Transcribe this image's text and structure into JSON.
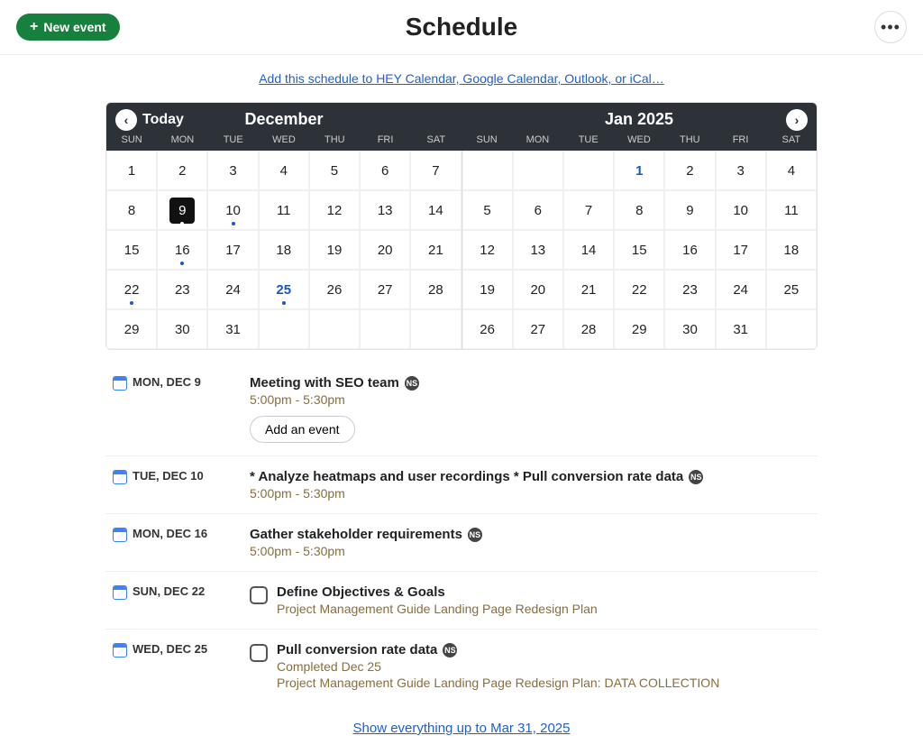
{
  "header": {
    "new_event_label": "New event",
    "title": "Schedule",
    "more_label": "•••"
  },
  "add_schedule_link": "Add this schedule to HEY Calendar, Google Calendar, Outlook, or iCal…",
  "calendar": {
    "today_label": "Today",
    "dow": [
      "SUN",
      "MON",
      "TUE",
      "WED",
      "THU",
      "FRI",
      "SAT"
    ],
    "months": [
      {
        "title": "December",
        "days": [
          {
            "n": 1
          },
          {
            "n": 2
          },
          {
            "n": 3
          },
          {
            "n": 4
          },
          {
            "n": 5
          },
          {
            "n": 6
          },
          {
            "n": 7
          },
          {
            "n": 8
          },
          {
            "n": 9,
            "selected": true,
            "dot": true
          },
          {
            "n": 10,
            "dot": true
          },
          {
            "n": 11
          },
          {
            "n": 12
          },
          {
            "n": 13
          },
          {
            "n": 14
          },
          {
            "n": 15
          },
          {
            "n": 16,
            "dot": true
          },
          {
            "n": 17
          },
          {
            "n": 18
          },
          {
            "n": 19
          },
          {
            "n": 20
          },
          {
            "n": 21
          },
          {
            "n": 22,
            "dot": true
          },
          {
            "n": 23
          },
          {
            "n": 24
          },
          {
            "n": 25,
            "holiday": true,
            "dot": true
          },
          {
            "n": 26
          },
          {
            "n": 27
          },
          {
            "n": 28
          },
          {
            "n": 29
          },
          {
            "n": 30
          },
          {
            "n": 31
          },
          {
            "n": ""
          },
          {
            "n": ""
          },
          {
            "n": ""
          },
          {
            "n": ""
          }
        ]
      },
      {
        "title": "Jan 2025",
        "days": [
          {
            "n": ""
          },
          {
            "n": ""
          },
          {
            "n": ""
          },
          {
            "n": 1,
            "holiday": true
          },
          {
            "n": 2
          },
          {
            "n": 3
          },
          {
            "n": 4
          },
          {
            "n": 5
          },
          {
            "n": 6
          },
          {
            "n": 7
          },
          {
            "n": 8
          },
          {
            "n": 9
          },
          {
            "n": 10
          },
          {
            "n": 11
          },
          {
            "n": 12
          },
          {
            "n": 13
          },
          {
            "n": 14
          },
          {
            "n": 15
          },
          {
            "n": 16
          },
          {
            "n": 17
          },
          {
            "n": 18
          },
          {
            "n": 19
          },
          {
            "n": 20
          },
          {
            "n": 21
          },
          {
            "n": 22
          },
          {
            "n": 23
          },
          {
            "n": 24
          },
          {
            "n": 25
          },
          {
            "n": 26
          },
          {
            "n": 27
          },
          {
            "n": 28
          },
          {
            "n": 29
          },
          {
            "n": 30
          },
          {
            "n": 31
          },
          {
            "n": ""
          }
        ]
      }
    ]
  },
  "agenda": [
    {
      "date": "MON, DEC 9",
      "type": "event",
      "title": "Meeting with SEO team",
      "badge": "NS",
      "time": "5:00pm - 5:30pm",
      "add_event_label": "Add an event",
      "show_add": true
    },
    {
      "date": "TUE, DEC 10",
      "type": "event",
      "title": "* Analyze heatmaps and user recordings * Pull conversion rate data",
      "badge": "NS",
      "time": "5:00pm - 5:30pm"
    },
    {
      "date": "MON, DEC 16",
      "type": "event",
      "title": "Gather stakeholder requirements",
      "badge": "NS",
      "time": "5:00pm - 5:30pm"
    },
    {
      "date": "SUN, DEC 22",
      "type": "todo",
      "title": "Define Objectives & Goals",
      "meta": "Project Management Guide Landing Page Redesign Plan"
    },
    {
      "date": "WED, DEC 25",
      "type": "todo",
      "title": "Pull conversion rate data",
      "badge": "NS",
      "completed": "Completed Dec 25",
      "meta": "Project Management Guide Landing Page Redesign Plan: DATA COLLECTION"
    }
  ],
  "show_more_label": "Show everything up to Mar 31, 2025"
}
